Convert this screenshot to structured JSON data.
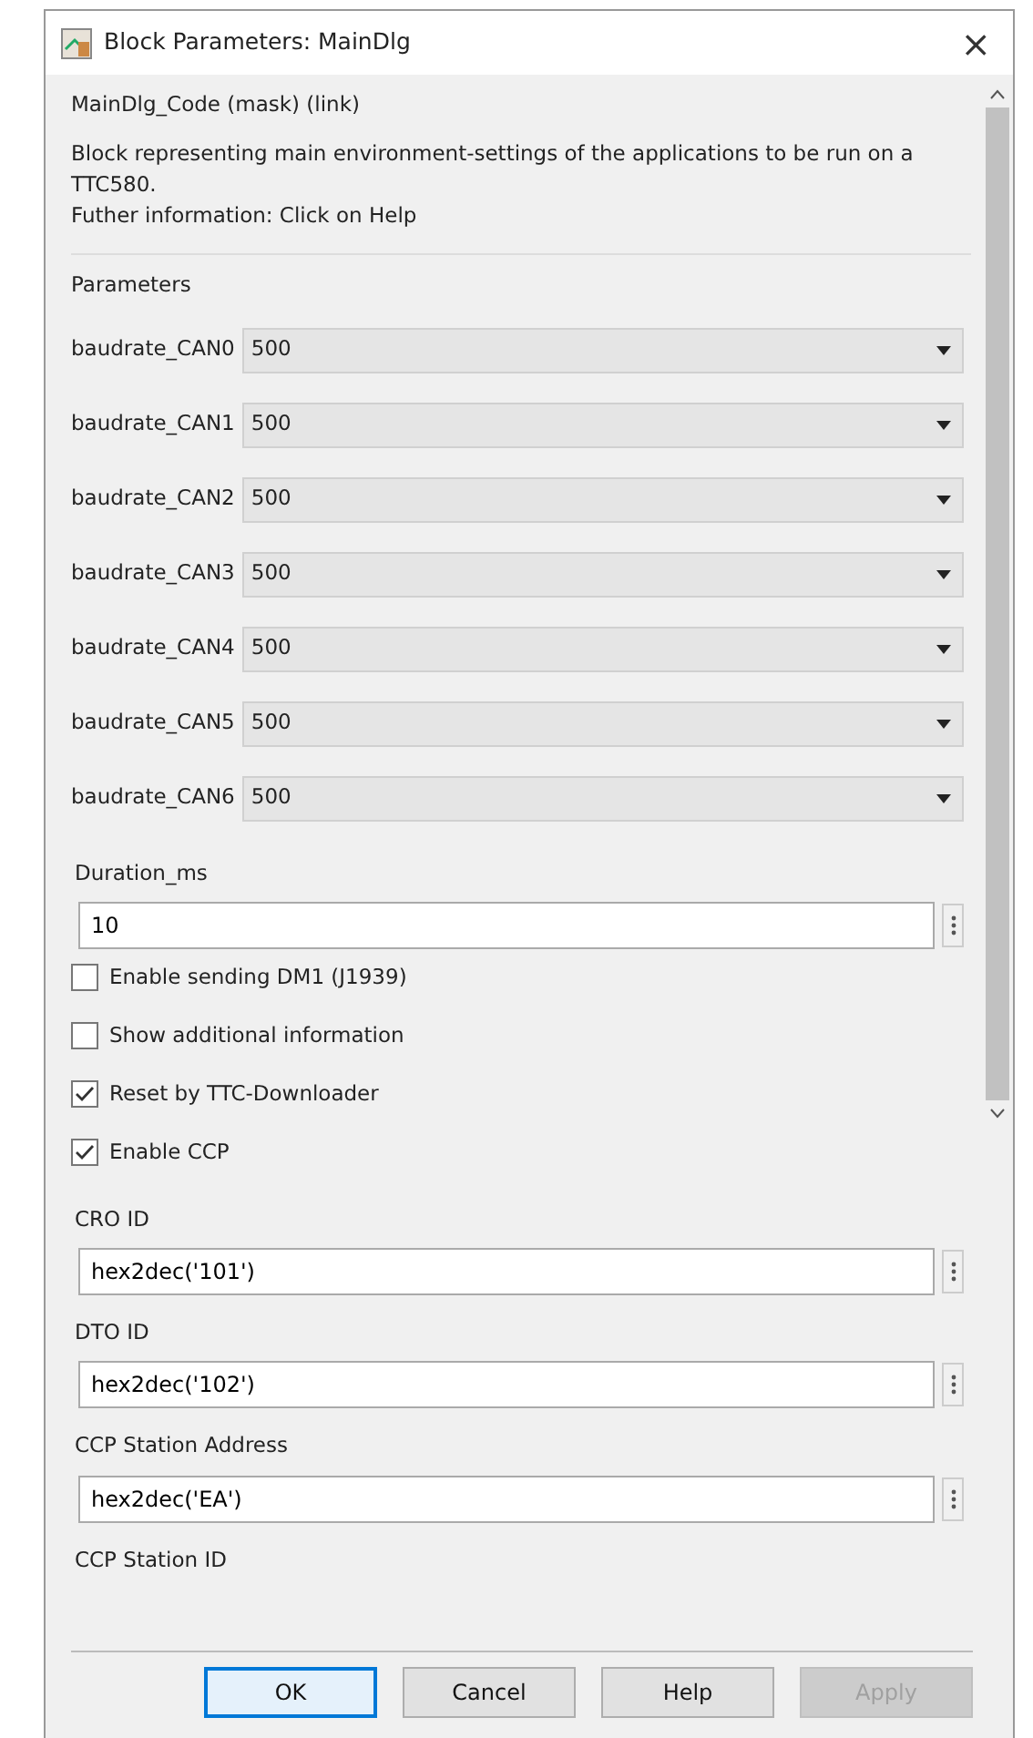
{
  "window": {
    "title": "Block Parameters: MainDlg",
    "close": "×"
  },
  "description": {
    "title": "MainDlg_Code (mask) (link)",
    "text": [
      "Block representing main environment-settings of the applications to be run on a TTC580.",
      "Futher information: Click on Help"
    ]
  },
  "parameters": {
    "title": "Parameters",
    "items": [
      {
        "kind": "dropdown",
        "label": "baudrate_CAN0",
        "value": "500"
      },
      {
        "kind": "dropdown",
        "label": "baudrate_CAN1",
        "value": "500"
      },
      {
        "kind": "dropdown",
        "label": "baudrate_CAN2",
        "value": "500"
      },
      {
        "kind": "dropdown",
        "label": "baudrate_CAN3",
        "value": "500"
      },
      {
        "kind": "dropdown",
        "label": "baudrate_CAN4",
        "value": "500"
      },
      {
        "kind": "dropdown",
        "label": "baudrate_CAN5",
        "value": "500"
      },
      {
        "kind": "dropdown",
        "label": "baudrate_CAN6",
        "value": "500"
      },
      {
        "kind": "edit",
        "label": "Duration_ms",
        "value": "10"
      },
      {
        "kind": "checkbox",
        "label": "Enable sending DM1 (J1939)",
        "checked": false
      },
      {
        "kind": "checkbox",
        "label": "Show additional information",
        "checked": false
      },
      {
        "kind": "checkbox",
        "label": "Reset by TTC-Downloader",
        "checked": true
      },
      {
        "kind": "checkbox",
        "label": "Enable CCP",
        "checked": true
      },
      {
        "kind": "edit",
        "label": "CRO ID",
        "value": "hex2dec('101')"
      },
      {
        "kind": "edit",
        "label": "DTO ID",
        "value": "hex2dec('102')"
      },
      {
        "kind": "edit",
        "label": "CCP Station Address",
        "value": "hex2dec('EA')"
      },
      {
        "kind": "heading",
        "label": "CCP Station ID"
      }
    ]
  },
  "buttons": [
    {
      "label": "OK",
      "default": true,
      "disabled": false
    },
    {
      "label": "Cancel",
      "default": false,
      "disabled": false
    },
    {
      "label": "Help",
      "default": false,
      "disabled": false
    },
    {
      "label": "Apply",
      "default": false,
      "disabled": true
    }
  ]
}
